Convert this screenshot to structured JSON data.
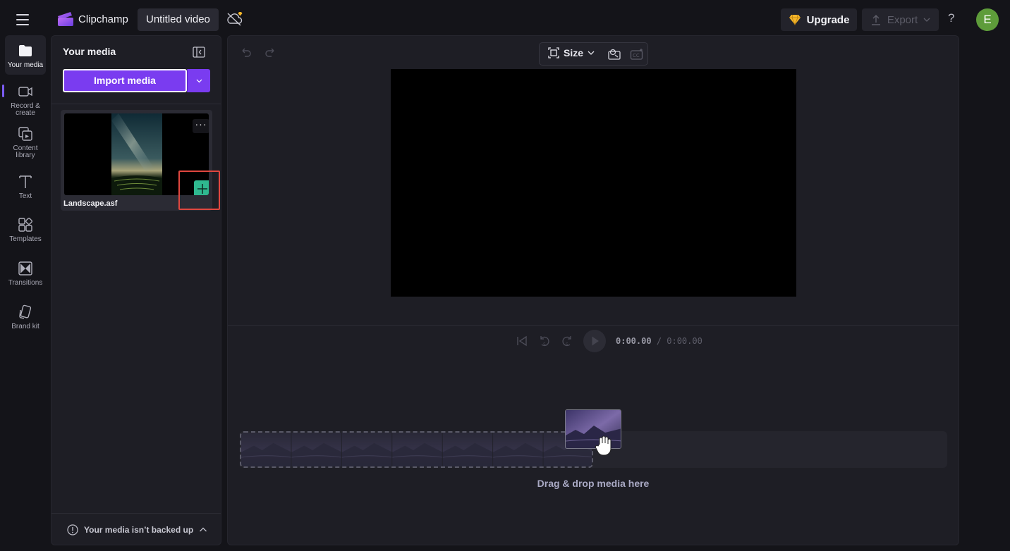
{
  "header": {
    "app_name": "Clipchamp",
    "project_title": "Untitled video",
    "upgrade_label": "Upgrade",
    "export_label": "Export",
    "help_label": "?",
    "avatar_initial": "E"
  },
  "sidebar": {
    "items": [
      {
        "label": "Your media",
        "icon": "folder-icon",
        "active": true
      },
      {
        "label": "Record & create",
        "icon": "video-camera-icon"
      },
      {
        "label": "Content library",
        "icon": "content-library-icon"
      },
      {
        "label": "Text",
        "icon": "text-icon"
      },
      {
        "label": "Templates",
        "icon": "templates-icon"
      },
      {
        "label": "Transitions",
        "icon": "transitions-icon"
      },
      {
        "label": "Brand kit",
        "icon": "brand-kit-icon"
      }
    ]
  },
  "media_panel": {
    "title": "Your media",
    "import_label": "Import media",
    "items": [
      {
        "name": "Landscape.asf",
        "more_label": "···"
      }
    ],
    "backup_text": "Your media isn’t backed up"
  },
  "editor": {
    "size_label": "Size",
    "timecode_current": "0:00.00",
    "timecode_total": "/ 0:00.00",
    "drop_label": "Drag & drop media here"
  },
  "colors": {
    "accent": "#7a3cf0",
    "add_button": "#2fb88f",
    "highlight": "#e0473f",
    "avatar": "#5e9c3a",
    "upgrade_gem": "#f5b62a"
  }
}
